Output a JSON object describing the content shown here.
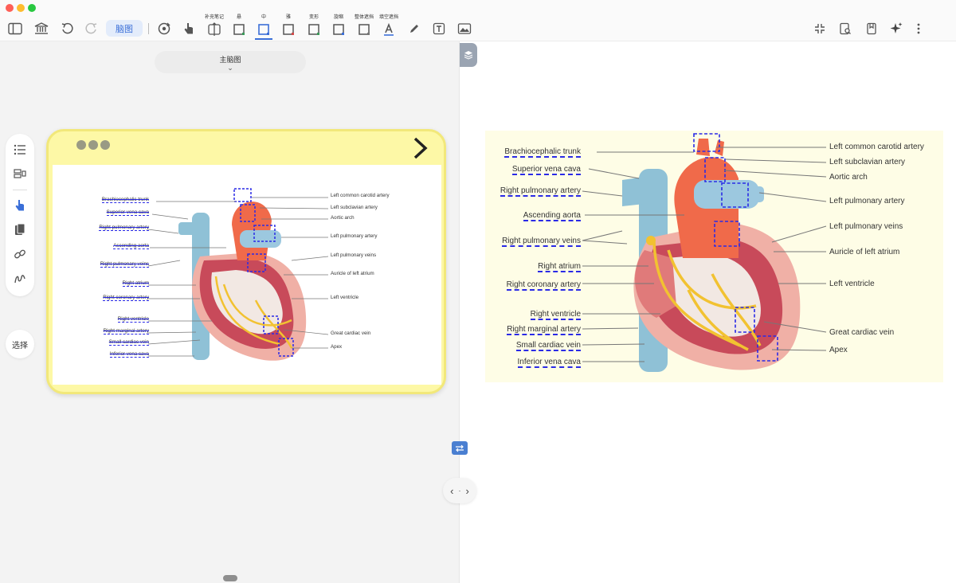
{
  "toolbar": {
    "mindmap_label": "脑图",
    "captions": {
      "supplement": "补充笔记",
      "border": "悬",
      "middle": "中",
      "dense": "雅",
      "transform": "变形",
      "rotate": "旋缩",
      "whole_mask": "整体遮挡",
      "fill_mask": "填空遮挡"
    }
  },
  "left": {
    "map_title": "主脑图",
    "select_label": "选择"
  },
  "diagram": {
    "left_labels": [
      {
        "text": "Brachiocephalic trunk",
        "occluded": true
      },
      {
        "text": "Superior vena cava",
        "occluded": true
      },
      {
        "text": "Right pulmonary artery",
        "occluded": true
      },
      {
        "text": "Ascending aorta",
        "occluded": true
      },
      {
        "text": "Right pulmonary veins",
        "occluded": true
      },
      {
        "text": "Right atrium",
        "occluded": true
      },
      {
        "text": "Right coronary artery",
        "occluded": true
      },
      {
        "text": "Right ventricle",
        "occluded": true
      },
      {
        "text": "Right marginal artery",
        "occluded": true
      },
      {
        "text": "Small cardiac vein",
        "occluded": true
      },
      {
        "text": "Inferior vena cava",
        "occluded": true
      }
    ],
    "right_labels": [
      {
        "text": "Left common carotid artery",
        "occluded": false
      },
      {
        "text": "Left subclavian artery",
        "occluded": false
      },
      {
        "text": "Aortic arch",
        "occluded": false
      },
      {
        "text": "Left pulmonary artery",
        "occluded": false
      },
      {
        "text": "Left pulmonary veins",
        "occluded": false
      },
      {
        "text": "Auricle of left atrium",
        "occluded": false
      },
      {
        "text": "Left ventricle",
        "occluded": false
      },
      {
        "text": "Great cardiac vein",
        "occluded": false
      },
      {
        "text": "Apex",
        "occluded": false
      }
    ]
  },
  "colors": {
    "accent": "#3b6fd8",
    "card_bg": "#fdf8a6",
    "mask_border": "#2a2ae6"
  }
}
